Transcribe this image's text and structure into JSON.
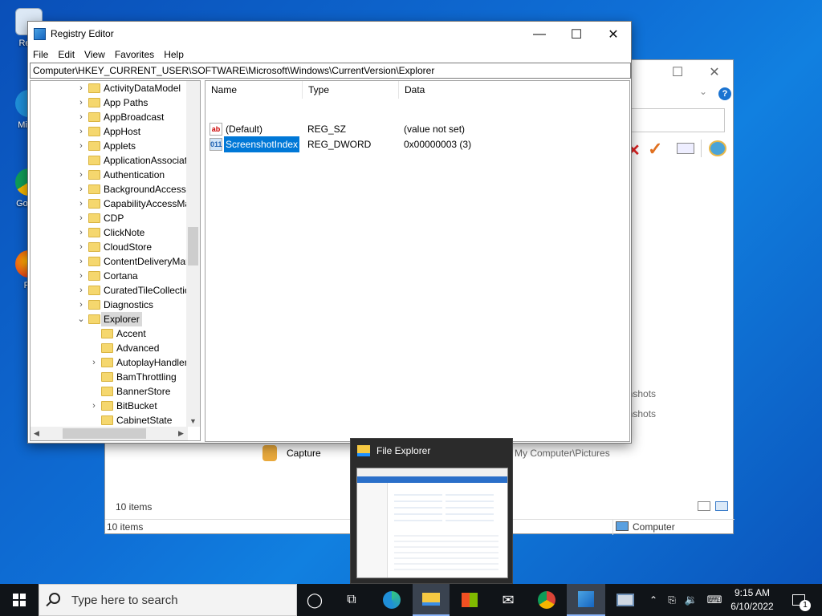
{
  "desktop": {
    "icons": [
      {
        "label": "Recy"
      },
      {
        "label": "Mic E"
      },
      {
        "label": "Go Ch"
      },
      {
        "label": "Fir"
      }
    ]
  },
  "back_window": {
    "list_items": [
      "enshots",
      "enshots"
    ],
    "capture_label": "Capture",
    "path_fragment": "My Computer\\Pictures",
    "status_items_inner": "10 items",
    "status_items": "10 items",
    "status_location": "Computer"
  },
  "regedit": {
    "title": "Registry Editor",
    "menu": [
      "File",
      "Edit",
      "View",
      "Favorites",
      "Help"
    ],
    "address": "Computer\\HKEY_CURRENT_USER\\SOFTWARE\\Microsoft\\Windows\\CurrentVersion\\Explorer",
    "tree": [
      {
        "label": "ActivityDataModel",
        "level": 1,
        "expander": "collapsed"
      },
      {
        "label": "App Paths",
        "level": 1,
        "expander": "collapsed"
      },
      {
        "label": "AppBroadcast",
        "level": 1,
        "expander": "collapsed"
      },
      {
        "label": "AppHost",
        "level": 1,
        "expander": "collapsed"
      },
      {
        "label": "Applets",
        "level": 1,
        "expander": "collapsed"
      },
      {
        "label": "ApplicationAssociati",
        "level": 1,
        "expander": "none"
      },
      {
        "label": "Authentication",
        "level": 1,
        "expander": "collapsed"
      },
      {
        "label": "BackgroundAccessA",
        "level": 1,
        "expander": "collapsed"
      },
      {
        "label": "CapabilityAccessMa",
        "level": 1,
        "expander": "collapsed"
      },
      {
        "label": "CDP",
        "level": 1,
        "expander": "collapsed"
      },
      {
        "label": "ClickNote",
        "level": 1,
        "expander": "collapsed"
      },
      {
        "label": "CloudStore",
        "level": 1,
        "expander": "collapsed"
      },
      {
        "label": "ContentDeliveryMan",
        "level": 1,
        "expander": "collapsed"
      },
      {
        "label": "Cortana",
        "level": 1,
        "expander": "collapsed"
      },
      {
        "label": "CuratedTileCollectio",
        "level": 1,
        "expander": "collapsed"
      },
      {
        "label": "Diagnostics",
        "level": 1,
        "expander": "collapsed"
      },
      {
        "label": "Explorer",
        "level": 1,
        "expander": "expanded",
        "selected": true
      },
      {
        "label": "Accent",
        "level": 2,
        "expander": "none"
      },
      {
        "label": "Advanced",
        "level": 2,
        "expander": "none"
      },
      {
        "label": "AutoplayHandler",
        "level": 2,
        "expander": "collapsed"
      },
      {
        "label": "BamThrottling",
        "level": 2,
        "expander": "none"
      },
      {
        "label": "BannerStore",
        "level": 2,
        "expander": "none"
      },
      {
        "label": "BitBucket",
        "level": 2,
        "expander": "collapsed"
      },
      {
        "label": "CabinetState",
        "level": 2,
        "expander": "none"
      }
    ],
    "columns": [
      "Name",
      "Type",
      "Data"
    ],
    "values": [
      {
        "icon": "ab",
        "name": "(Default)",
        "type": "REG_SZ",
        "data": "(value not set)"
      },
      {
        "icon": "011",
        "name": "ScreenshotIndex",
        "type": "REG_DWORD",
        "data": "0x00000003 (3)",
        "selected": true
      }
    ]
  },
  "thumbnail": {
    "title": "File Explorer"
  },
  "taskbar": {
    "search_placeholder": "Type here to search",
    "time": "9:15 AM",
    "date": "6/10/2022",
    "notification_count": "1"
  }
}
